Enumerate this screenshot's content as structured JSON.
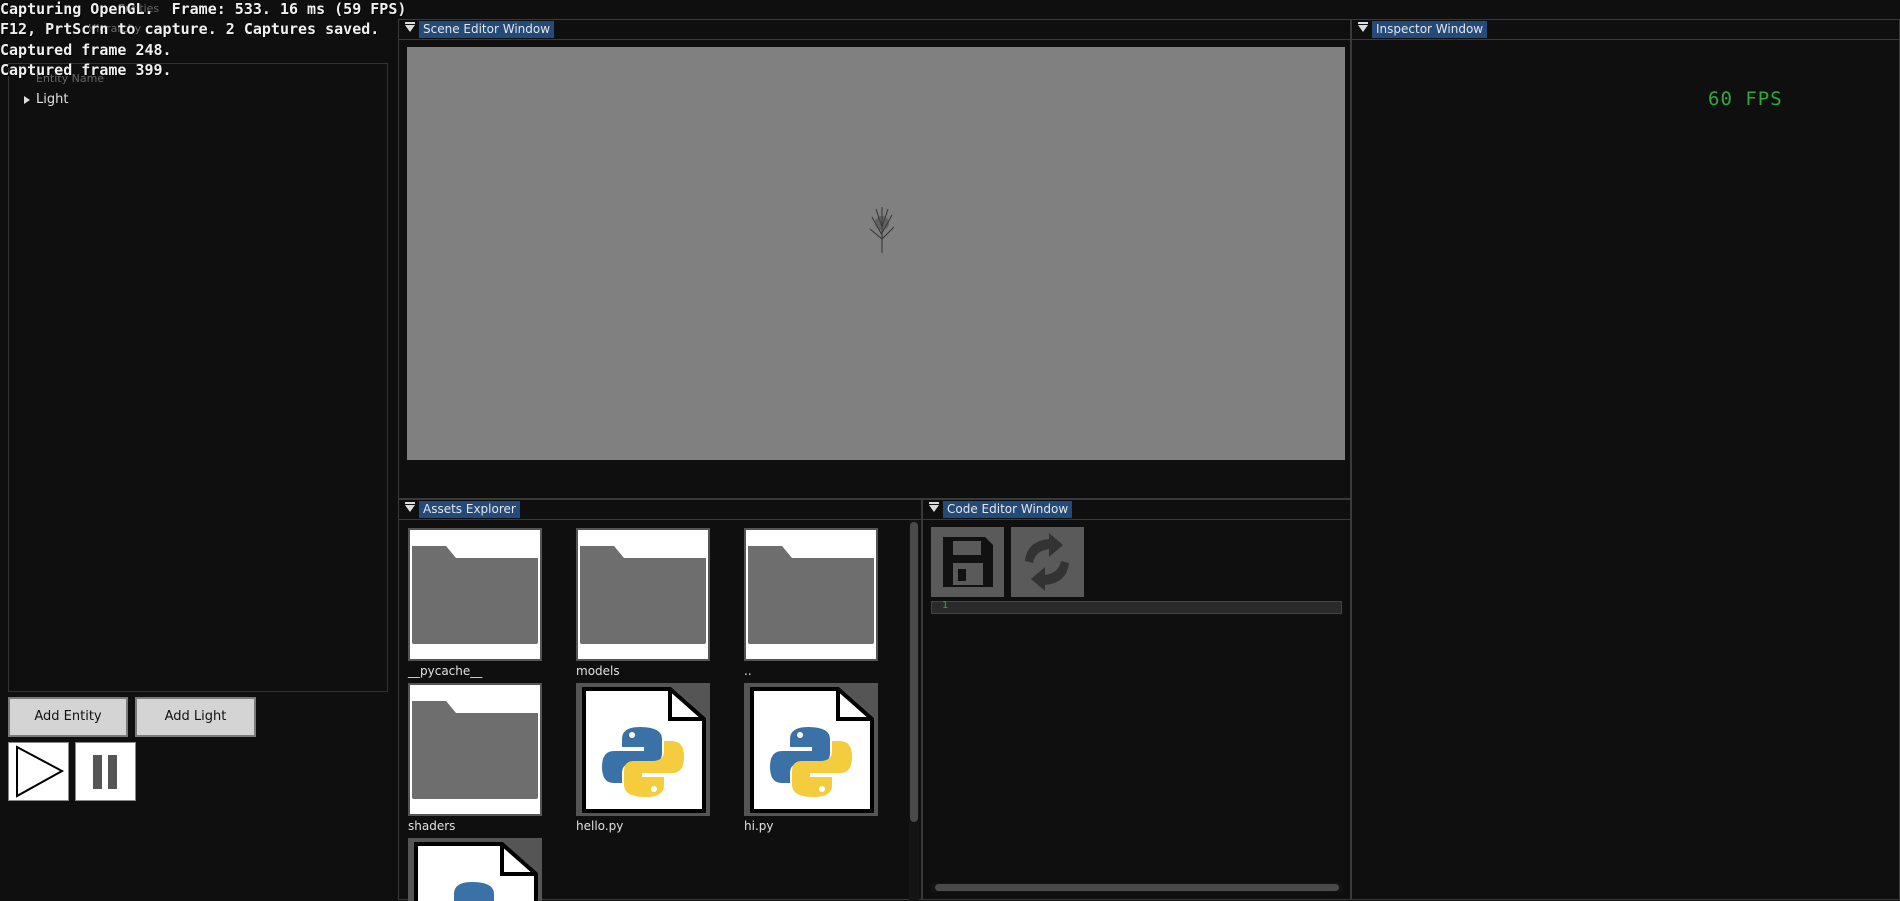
{
  "overlay": {
    "line1": "Capturing OpenGL.  Frame: 533. 16 ms (59 FPS)",
    "line2": "F12, PrtScrn to capture. 2 Captures saved.",
    "line3": "Captured frame 248.",
    "line4": "Captured frame 399."
  },
  "hierarchy": {
    "ghost_title": "Entities",
    "ghost_tab": "Hierarchy",
    "ghost_sub": "Entity Name",
    "tree_item": "Light",
    "add_entity": "Add Entity",
    "add_light": "Add Light"
  },
  "scene": {
    "title": "Scene Editor Window",
    "viewport_color": "#808080"
  },
  "inspector": {
    "title": "Inspector Window",
    "fps": "60 FPS",
    "fps_color": "#2faa3a"
  },
  "assets": {
    "title": "Assets Explorer",
    "items": [
      {
        "label": "__pycache__",
        "icon": "folder-icon"
      },
      {
        "label": "models",
        "icon": "folder-icon"
      },
      {
        "label": "..",
        "icon": "folder-icon"
      },
      {
        "label": "shaders",
        "icon": "folder-icon"
      },
      {
        "label": "hello.py",
        "icon": "python-file-icon"
      },
      {
        "label": "hi.py",
        "icon": "python-file-icon"
      },
      {
        "label": "",
        "icon": "python-file-icon"
      }
    ]
  },
  "code_editor": {
    "title": "Code Editor Window",
    "line_number": "1"
  },
  "accent": "#244a7a"
}
